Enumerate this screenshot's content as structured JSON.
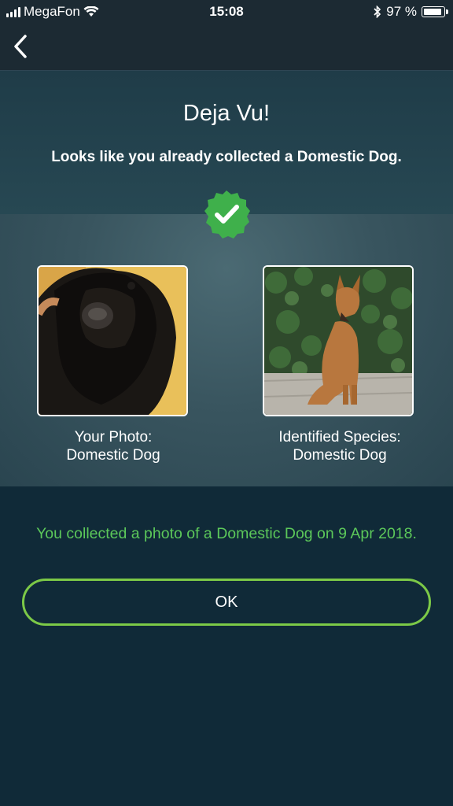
{
  "status_bar": {
    "carrier": "MegaFon",
    "time": "15:08",
    "battery": "97 %"
  },
  "nav": {
    "back_icon": "chevron-left-icon"
  },
  "header": {
    "title": "Deja Vu!",
    "subtitle": "Looks like you already collected a Domestic Dog."
  },
  "comparison": {
    "badge_icon": "check-badge-icon",
    "your_photo": {
      "label": "Your Photo:",
      "name": "Domestic Dog"
    },
    "identified": {
      "label": "Identified Species:",
      "name": "Domestic Dog"
    }
  },
  "message": "You collected a photo of a Domestic Dog on 9 Apr 2018.",
  "ok_button": "OK",
  "colors": {
    "accent_green": "#5cc85a",
    "button_border": "#7cc947",
    "background": "#102a38"
  }
}
